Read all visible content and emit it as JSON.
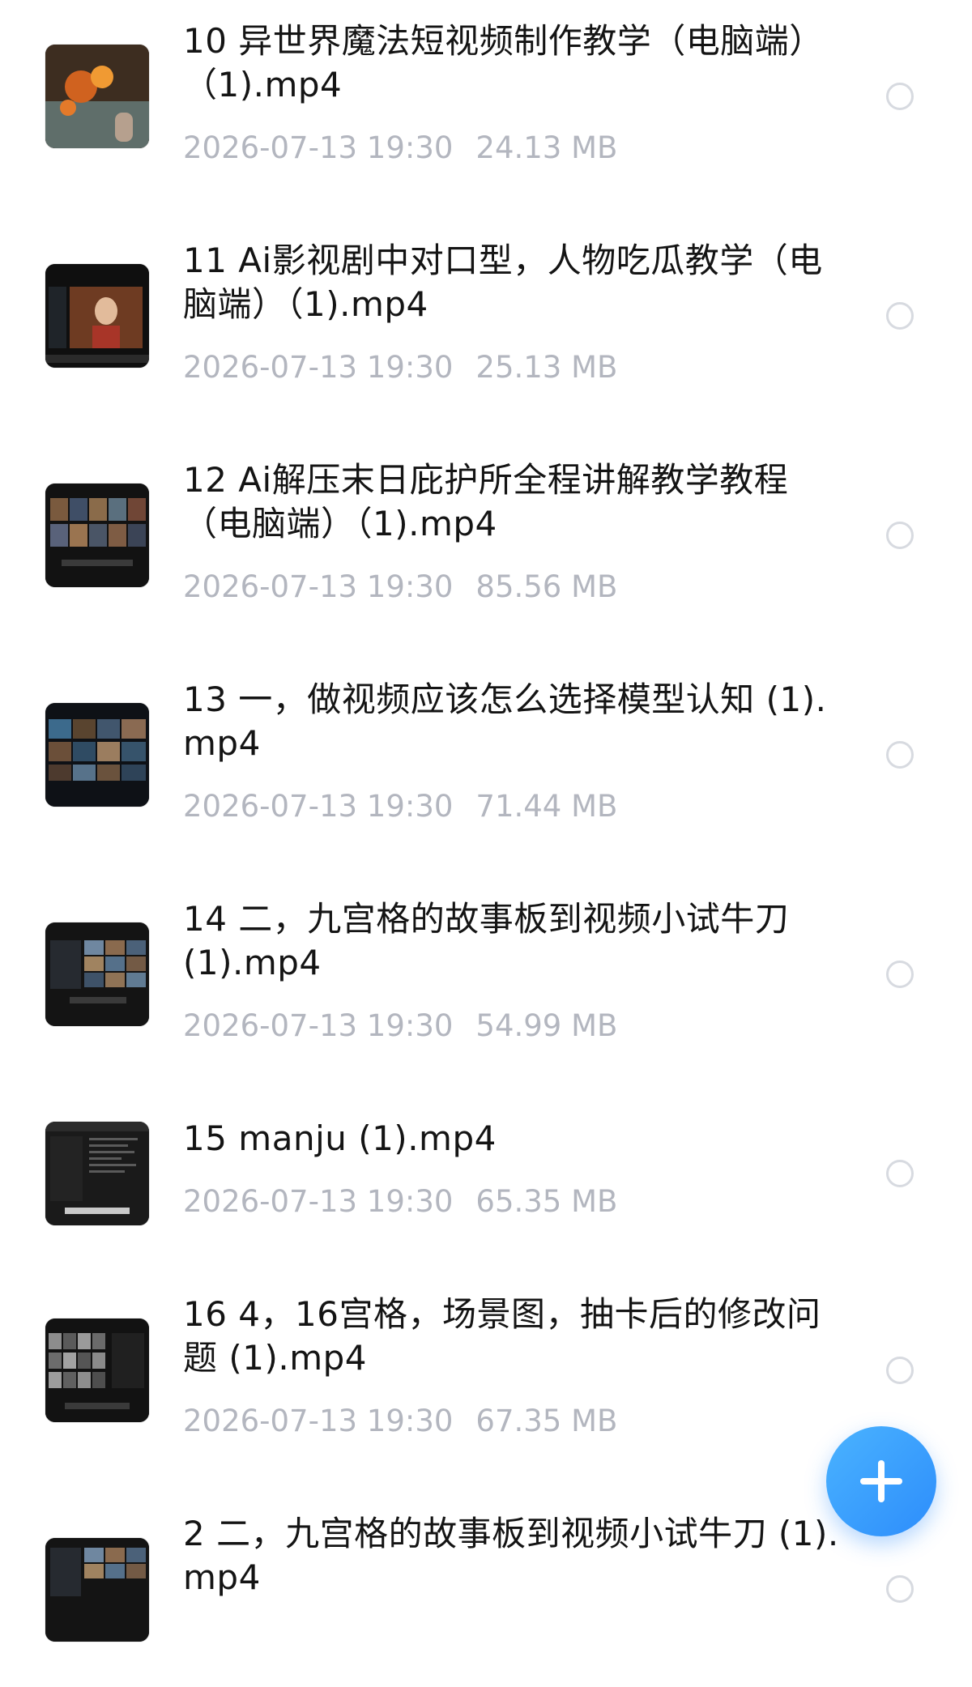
{
  "files": [
    {
      "name": "10 异世界魔法短视频制作教学（电脑端）（1).mp4",
      "date": "2026-07-13 19:30",
      "size": "24.13 MB",
      "thumb": "fire-scene-icon"
    },
    {
      "name": "11 Ai影视剧中对口型，人物吃瓜教学（电脑端）（1).mp4",
      "date": "2026-07-13 19:30",
      "size": "25.13 MB",
      "thumb": "drama-portrait-icon"
    },
    {
      "name": "12 Ai解压末日庇护所全程讲解教学教程（电脑端）（1).mp4",
      "date": "2026-07-13 19:30",
      "size": "85.56 MB",
      "thumb": "image-grid-icon"
    },
    {
      "name": "13 一，做视频应该怎么选择模型认知 (1).mp4",
      "date": "2026-07-13 19:30",
      "size": "71.44 MB",
      "thumb": "image-grid-icon"
    },
    {
      "name": "14 二，九宫格的故事板到视频小试牛刀 (1).mp4",
      "date": "2026-07-13 19:30",
      "size": "54.99 MB",
      "thumb": "storyboard-icon"
    },
    {
      "name": "15 manju (1).mp4",
      "date": "2026-07-13 19:30",
      "size": "65.35 MB",
      "thumb": "code-editor-icon"
    },
    {
      "name": "16 4，16宫格，场景图，抽卡后的修改问题 (1).mp4",
      "date": "2026-07-13 19:30",
      "size": "67.35 MB",
      "thumb": "image-grid-icon"
    },
    {
      "name": "2 二，九宫格的故事板到视频小试牛刀 (1).mp4",
      "date": "",
      "size": "",
      "thumb": "storyboard-icon"
    }
  ],
  "fab": {
    "icon": "plus-icon",
    "color": "#2d8dfb"
  },
  "colors": {
    "meta_text": "#b3b6bf",
    "radio_border": "#d7dae0",
    "title_text": "#141414"
  }
}
